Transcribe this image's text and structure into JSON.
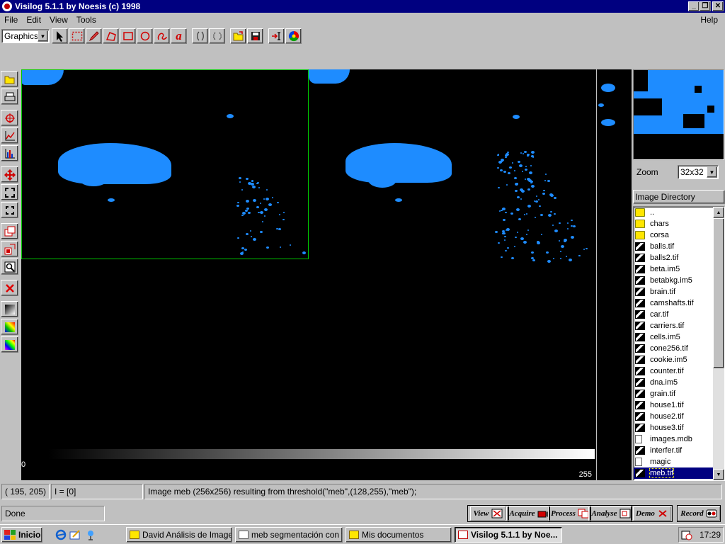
{
  "window": {
    "title": "Visilog 5.1.1 by Noesis (c) 1998"
  },
  "menu": {
    "file": "File",
    "edit": "Edit",
    "view": "View",
    "tools": "Tools",
    "help": "Help"
  },
  "toolbar": {
    "mode": "Graphics",
    "text_tool": "a"
  },
  "canvas": {
    "ramp_min": "0",
    "ramp_max": "255"
  },
  "zoom": {
    "label": "Zoom",
    "value": "32x32"
  },
  "directory": {
    "header": "Image Directory",
    "items": [
      {
        "name": "..",
        "type": "folder"
      },
      {
        "name": "chars",
        "type": "folder"
      },
      {
        "name": "corsa",
        "type": "folder"
      },
      {
        "name": "balls.tif",
        "type": "image"
      },
      {
        "name": "balls2.tif",
        "type": "image"
      },
      {
        "name": "beta.im5",
        "type": "image"
      },
      {
        "name": "betabkg.im5",
        "type": "image"
      },
      {
        "name": "brain.tif",
        "type": "image"
      },
      {
        "name": "camshafts.tif",
        "type": "image"
      },
      {
        "name": "car.tif",
        "type": "image"
      },
      {
        "name": "carriers.tif",
        "type": "image"
      },
      {
        "name": "cells.im5",
        "type": "image"
      },
      {
        "name": "cone256.tif",
        "type": "image"
      },
      {
        "name": "cookie.im5",
        "type": "image"
      },
      {
        "name": "counter.tif",
        "type": "image"
      },
      {
        "name": "dna.im5",
        "type": "image"
      },
      {
        "name": "grain.tif",
        "type": "image"
      },
      {
        "name": "house1.tif",
        "type": "image"
      },
      {
        "name": "house2.tif",
        "type": "image"
      },
      {
        "name": "house3.tif",
        "type": "image"
      },
      {
        "name": "images.mdb",
        "type": "file"
      },
      {
        "name": "interfer.tif",
        "type": "image"
      },
      {
        "name": "magic",
        "type": "file"
      },
      {
        "name": "meb.tif",
        "type": "image",
        "selected": true
      }
    ]
  },
  "status": {
    "coords": "( 195, 205)",
    "intensity": "I = [0]",
    "message": "Image meb (256x256) resulting from threshold(\"meb\",(128,255),\"meb\");",
    "state": "Done"
  },
  "modules": {
    "view": "View",
    "acquire": "Acquire",
    "process": "Process",
    "analyse": "Analyse",
    "demo": "Demo",
    "record": "Record"
  },
  "taskbar": {
    "start": "Inicio",
    "tasks": [
      "David Análisis de Imagen",
      "meb segmentación con fi...",
      "Mis documentos",
      "Visilog 5.1.1 by Noe..."
    ],
    "clock": "17:29"
  },
  "colors": {
    "blob": "#1e8cff",
    "selection": "#00c800",
    "titlebar": "#000080"
  }
}
